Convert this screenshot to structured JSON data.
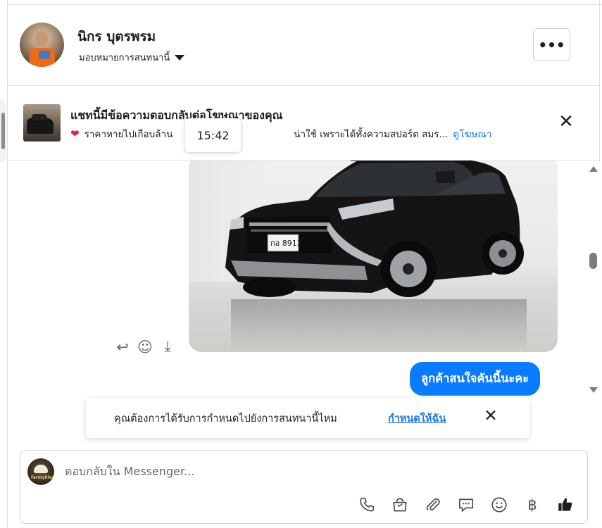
{
  "header": {
    "contact_name": "นิกร บุตรพรม",
    "assign_label": "มอบหมายการสนทนานี้",
    "more_label": "•••"
  },
  "ad_banner": {
    "title": "แชทนี้มีข้อความตอบกลับต่อโฆษณาของคุณ",
    "description_start": "ราคาหายไปเกือบล้าน",
    "description_end": "น่าใช้ เพราะได้ทั้งความสปอร์ต สมร...",
    "view_ad_link": "ดูโฆษณา",
    "close_label": "✕",
    "tooltip_time": "15:42"
  },
  "conversation": {
    "photo_alt": "Black Mitsubishi Pajero Sport SUV",
    "plate_text": "กอ 8913",
    "outgoing_message": "ลูกค้าสนใจคันนี้นะคะ"
  },
  "assign_prompt": {
    "text": "คุณต้องการได้รับการกำหนดไปยังการสนทนานี้ไหม",
    "action_link": "กำหนดให้ฉัน",
    "close_label": "✕"
  },
  "composer": {
    "placeholder": "ตอบกลับใน Messenger...",
    "page_logo_text": "farmyklen",
    "tools": [
      {
        "name": "phone-icon",
        "glyph": "☏"
      },
      {
        "name": "shop-bag-icon",
        "glyph": "bag"
      },
      {
        "name": "paperclip-icon",
        "glyph": "clip"
      },
      {
        "name": "saved-reply-icon",
        "glyph": "reply"
      },
      {
        "name": "emoji-icon",
        "glyph": "☺"
      },
      {
        "name": "baht-icon",
        "glyph": "฿"
      },
      {
        "name": "thumbs-up-icon",
        "glyph": "like"
      }
    ]
  },
  "colors": {
    "accent": "#0a7cff",
    "link": "#1877f2",
    "heart": "#e41e3f"
  }
}
